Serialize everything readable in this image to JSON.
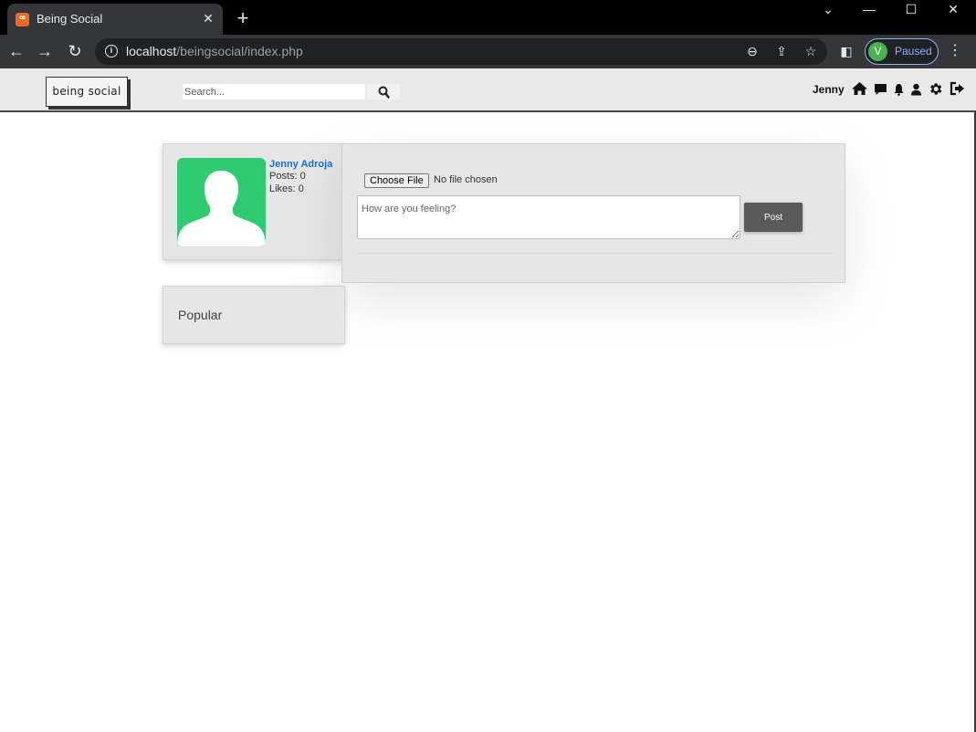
{
  "browser": {
    "tab_title": "Being Social",
    "tab_favicon": "xampp-icon",
    "url_host": "localhost",
    "url_path": "/beingsocial/index.php",
    "profile_initial": "V",
    "profile_status": "Paused"
  },
  "header": {
    "logo_text": "being social",
    "search_placeholder": "Search...",
    "username": "Jenny",
    "nav_icons": [
      "home-icon",
      "messages-icon",
      "notifications-icon",
      "profile-icon",
      "settings-icon",
      "logout-icon"
    ]
  },
  "profile": {
    "name": "Jenny Adroja",
    "posts_label": "Posts: 0",
    "likes_label": "Likes: 0",
    "avatar_color": "#2ecc71"
  },
  "composer": {
    "file_button_label": "Choose File",
    "file_status": "No file chosen",
    "textarea_placeholder": "How are you feeling?",
    "post_button_label": "Post"
  },
  "popular": {
    "title": "Popular"
  }
}
